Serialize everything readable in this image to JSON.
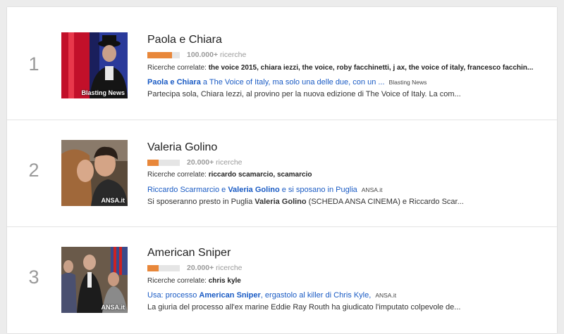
{
  "trends": [
    {
      "rank": "1",
      "title": "Paola e Chiara",
      "volume_bold": "100.000+",
      "volume_suffix": "ricerche",
      "volume_fraction": 0.75,
      "related_label": "Ricerche correlate:",
      "related_terms": "the voice 2015, chiara iezzi, the voice, roby facchinetti, j ax, the voice of italy, francesco facchin...",
      "news_bold": "Paola e Chiara",
      "news_rest": " a The Voice of Italy, ma solo una delle due, con un ...",
      "news_source": "Blasting News",
      "snippet": "Partecipa sola, Chiara Iezzi, al provino per la nuova edizione di The Voice of Italy. La com...",
      "image_label": "Blasting News",
      "image_icon": "the-voice-performer-image"
    },
    {
      "rank": "2",
      "title": "Valeria Golino",
      "volume_bold": "20.000+",
      "volume_suffix": "ricerche",
      "volume_fraction": 0.35,
      "related_label": "Ricerche correlate:",
      "related_terms": "riccardo scamarcio, scamarcio",
      "news_pre": "Riccardo Scarmarcio e ",
      "news_bold": "Valeria Golino",
      "news_rest": " e si sposano in Puglia",
      "news_source": "ANSA.it",
      "snippet_pre": "Si sposeranno presto in Puglia ",
      "snippet_bold": "Valeria Golino",
      "snippet_rest": " (SCHEDA ANSA CINEMA) e Riccardo Scar...",
      "image_label": "ANSA.it",
      "image_icon": "couple-kiss-image"
    },
    {
      "rank": "3",
      "title": "American Sniper",
      "volume_bold": "20.000+",
      "volume_suffix": "ricerche",
      "volume_fraction": 0.35,
      "related_label": "Ricerche correlate:",
      "related_terms": "chris kyle",
      "news_pre": "Usa: processo ",
      "news_bold": "American Sniper",
      "news_rest": ", ergastolo al killer di Chris Kyle,",
      "news_source": "ANSA.it",
      "snippet": "La giuria del processo all'ex marine Eddie Ray Routh ha giudicato l'imputato colpevole de...",
      "image_label": "ANSA.it",
      "image_icon": "courtroom-image"
    }
  ],
  "colors": {
    "accent_bar": "#e8873a",
    "link": "#1a5bc4"
  }
}
